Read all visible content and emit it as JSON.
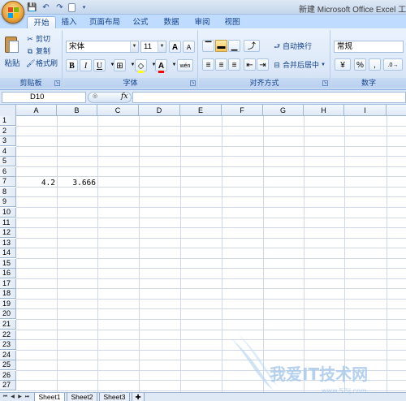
{
  "title_bar": {
    "title": "新建 Microsoft Office Excel 工作"
  },
  "qat": {
    "save_icon": "💾",
    "undo_icon": "↶",
    "redo_icon": "↷",
    "more_icon": "▾"
  },
  "tabs": [
    {
      "label": "开始",
      "active": true
    },
    {
      "label": "插入"
    },
    {
      "label": "页面布局"
    },
    {
      "label": "公式"
    },
    {
      "label": "数据"
    },
    {
      "label": "审阅"
    },
    {
      "label": "视图"
    }
  ],
  "clipboard": {
    "paste_label": "粘贴",
    "cut_label": "剪切",
    "copy_label": "复制",
    "format_painter_label": "格式刷",
    "group_label": "剪贴板"
  },
  "font": {
    "font_name": "宋体",
    "font_size": "11",
    "grow_icon": "A",
    "shrink_icon": "A",
    "bold": "B",
    "italic": "I",
    "underline": "U",
    "group_label": "字体",
    "phonetic_icon": "wén"
  },
  "alignment": {
    "wrap_label": "自动换行",
    "merge_label": "合并后居中",
    "group_label": "对齐方式"
  },
  "number": {
    "format": "常规",
    "percent_icon": "%",
    "comma_icon": ",",
    "group_label": "数字"
  },
  "formula_bar": {
    "name_box": "D10",
    "fx": "fx",
    "value": ""
  },
  "columns": [
    "A",
    "B",
    "C",
    "D",
    "E",
    "F",
    "G",
    "H",
    "I"
  ],
  "rows": [
    "1",
    "2",
    "3",
    "4",
    "5",
    "6",
    "7",
    "8",
    "9",
    "10",
    "11",
    "12",
    "13",
    "14",
    "15",
    "16",
    "17",
    "18",
    "19",
    "20",
    "21",
    "22",
    "23",
    "24",
    "25",
    "26",
    "27"
  ],
  "cells": [
    {
      "ref": "A7",
      "value": "4.2"
    },
    {
      "ref": "B7",
      "value": "3.666"
    }
  ],
  "sheets": [
    {
      "name": "Sheet1",
      "active": true
    },
    {
      "name": "Sheet2"
    },
    {
      "name": "Sheet3"
    }
  ],
  "watermark": {
    "text": "我爱IT技术网",
    "url": "www.52ij.com"
  }
}
